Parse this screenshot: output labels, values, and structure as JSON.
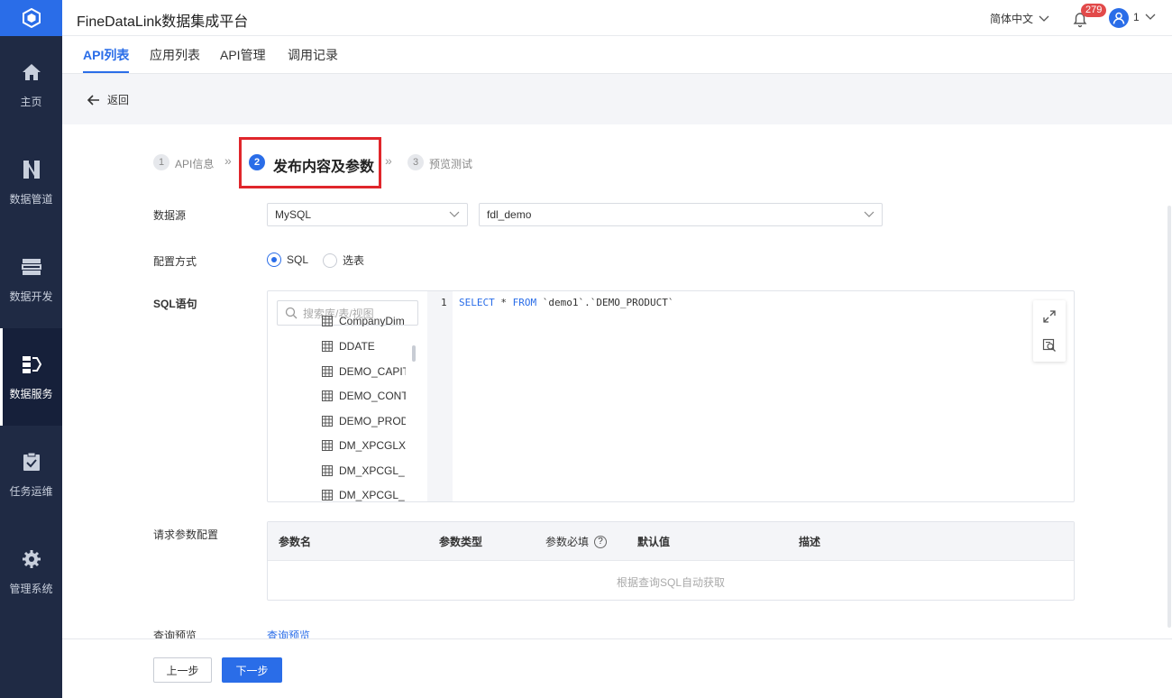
{
  "app": {
    "title": "FineDataLink数据集成平台"
  },
  "header": {
    "language": "简体中文",
    "notification_count": "279",
    "user": "1"
  },
  "sidebar": {
    "items": [
      {
        "label": "主页",
        "icon": "home-icon"
      },
      {
        "label": "数据管道",
        "icon": "pipeline-icon"
      },
      {
        "label": "数据开发",
        "icon": "dev-icon"
      },
      {
        "label": "数据服务",
        "icon": "data-service-icon",
        "active": true
      },
      {
        "label": "任务运维",
        "icon": "task-ops-icon"
      },
      {
        "label": "管理系统",
        "icon": "gear-icon"
      }
    ]
  },
  "tabs": [
    {
      "label": "API列表",
      "active": true
    },
    {
      "label": "应用列表"
    },
    {
      "label": "API管理"
    },
    {
      "label": "调用记录"
    }
  ],
  "back": {
    "label": "返回"
  },
  "steps": [
    {
      "num": "1",
      "label": "API信息"
    },
    {
      "num": "2",
      "label": "发布内容及参数",
      "active": true
    },
    {
      "num": "3",
      "label": "预览测试"
    }
  ],
  "form": {
    "datasource_label": "数据源",
    "datasource_type": "MySQL",
    "datasource_name": "fdl_demo",
    "config_label": "配置方式",
    "config_options": [
      {
        "label": "SQL",
        "checked": true
      },
      {
        "label": "选表",
        "checked": false
      }
    ],
    "sql_label": "SQL语句",
    "tree_search_placeholder": "搜索库/表/视图",
    "tree_items": [
      "CompanyDim",
      "DDATE",
      "DEMO_CAPITAL",
      "DEMO_CONTRACT",
      "DEMO_PRODUCT",
      "DM_XPCGLX",
      "DM_XPCGL_",
      "DM_XPCGL_"
    ],
    "sql_line_no": "1",
    "sql_code": {
      "kw1": "SELECT",
      "mid": " * ",
      "kw2": "FROM",
      "rest": " `demo1`.`DEMO_PRODUCT`"
    },
    "params_label": "请求参数配置",
    "params_columns": [
      "参数名",
      "参数类型",
      "参数必填",
      "默认值",
      "描述"
    ],
    "params_empty": "根据查询SQL自动获取",
    "preview_label": "查询预览",
    "preview_link": "查询预览"
  },
  "footer": {
    "prev": "上一步",
    "next": "下一步"
  },
  "colors": {
    "sidebar_bg": "#1f2a44",
    "accent": "#2a6de8",
    "highlight": "#e0262b"
  }
}
